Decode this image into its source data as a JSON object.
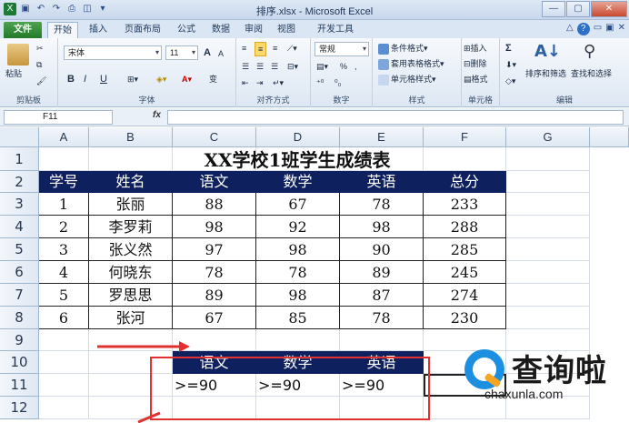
{
  "window": {
    "title": "排序.xlsx - Microsoft Excel",
    "min": "—",
    "max": "▢",
    "close": "✕"
  },
  "ribbon_tabs": [
    "文件",
    "开始",
    "插入",
    "页面布局",
    "公式",
    "数据",
    "审阅",
    "视图",
    "开发工具"
  ],
  "active_tab": "开始",
  "ribbon": {
    "clipboard": {
      "paste": "粘贴",
      "group": "剪贴板"
    },
    "font": {
      "name": "宋体",
      "size": "11",
      "bold": "B",
      "italic": "I",
      "underline": "U",
      "grow": "A",
      "shrink": "A",
      "group": "字体",
      "wen": "变"
    },
    "alignment": {
      "group": "对齐方式"
    },
    "number": {
      "format": "常规",
      "percent": "%",
      "comma": ",",
      "group": "数字"
    },
    "styles": {
      "conditional": "条件格式",
      "table": "套用表格格式",
      "cell": "单元格样式",
      "group": "样式"
    },
    "cells": {
      "insert": "插入",
      "delete": "删除",
      "format": "格式",
      "group": "单元格"
    },
    "editing": {
      "sum": "Σ",
      "sort": "排序和筛选",
      "find": "查找和选择",
      "group": "编辑"
    }
  },
  "formula_bar": {
    "name_box": "F11",
    "fx": "fx",
    "value": ""
  },
  "columns": [
    "A",
    "B",
    "C",
    "D",
    "E",
    "F",
    "G"
  ],
  "rows": [
    "1",
    "2",
    "3",
    "4",
    "5",
    "6",
    "7",
    "8",
    "9",
    "10",
    "11",
    "12"
  ],
  "sheet": {
    "title": "XX学校1班学生成绩表",
    "headers": [
      "学号",
      "姓名",
      "语文",
      "数学",
      "英语",
      "总分"
    ],
    "records": [
      [
        "1",
        "张丽",
        "88",
        "67",
        "78",
        "233"
      ],
      [
        "2",
        "李罗莉",
        "98",
        "92",
        "98",
        "288"
      ],
      [
        "3",
        "张义然",
        "97",
        "98",
        "90",
        "285"
      ],
      [
        "4",
        "何晓东",
        "78",
        "78",
        "89",
        "245"
      ],
      [
        "5",
        "罗思思",
        "89",
        "98",
        "87",
        "274"
      ],
      [
        "6",
        "张河",
        "67",
        "85",
        "78",
        "230"
      ]
    ],
    "criteria_headers": [
      "语文",
      "数学",
      "英语"
    ],
    "criteria_values": [
      ">=90",
      ">=90",
      ">=90"
    ]
  },
  "watermark": {
    "text": "查询啦",
    "url": "chaxunla.com"
  },
  "colors": {
    "header_bg": "#0f205f",
    "annotation": "#e03030",
    "file_tab": "#227b2a"
  }
}
